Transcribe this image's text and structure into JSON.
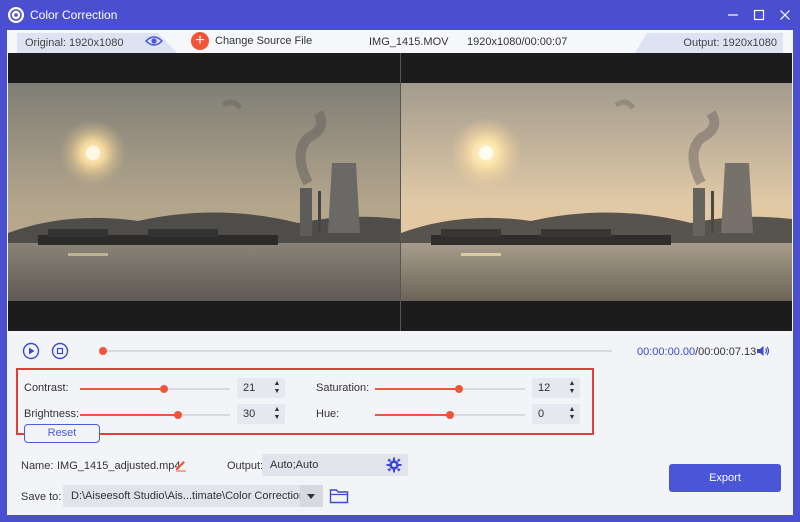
{
  "window": {
    "title": "Color Correction"
  },
  "infobar": {
    "original_label": "Original: 1920x1080",
    "change_source_label": "Change Source File",
    "file_name": "IMG_1415.MOV",
    "file_dims_duration": "1920x1080/00:00:07",
    "output_label": "Output: 1920x1080"
  },
  "playback": {
    "current_time": "00:00:00.00",
    "total_time": "/00:00:07.13",
    "progress": 0
  },
  "adjustments": {
    "contrast": {
      "label": "Contrast:",
      "value": "21",
      "fraction": 0.56
    },
    "saturation": {
      "label": "Saturation:",
      "value": "12",
      "fraction": 0.56
    },
    "brightness": {
      "label": "Brightness:",
      "value": "30",
      "fraction": 0.65
    },
    "hue": {
      "label": "Hue:",
      "value": "0",
      "fraction": 0.5
    },
    "reset_label": "Reset"
  },
  "bottom": {
    "name_label": "Name:",
    "name_value": "IMG_1415_adjusted.mp4",
    "output_label": "Output:",
    "output_value": "Auto;Auto",
    "save_label": "Save to:",
    "save_value": "D:\\Aiseesoft Studio\\Ais...timate\\Color Correction",
    "export_label": "Export"
  },
  "colors": {
    "accent": "#4a4fcf",
    "slider": "#f0553a",
    "highlight_box": "#e33c3c",
    "export": "#4a55d8"
  },
  "icons": {
    "app": "palette-icon",
    "eye": "eye-icon",
    "add": "plus-circle-icon",
    "play": "play-icon",
    "stop": "stop-icon",
    "volume": "volume-icon",
    "edit": "pencil-icon",
    "gear": "gear-icon",
    "folder": "folder-icon"
  }
}
